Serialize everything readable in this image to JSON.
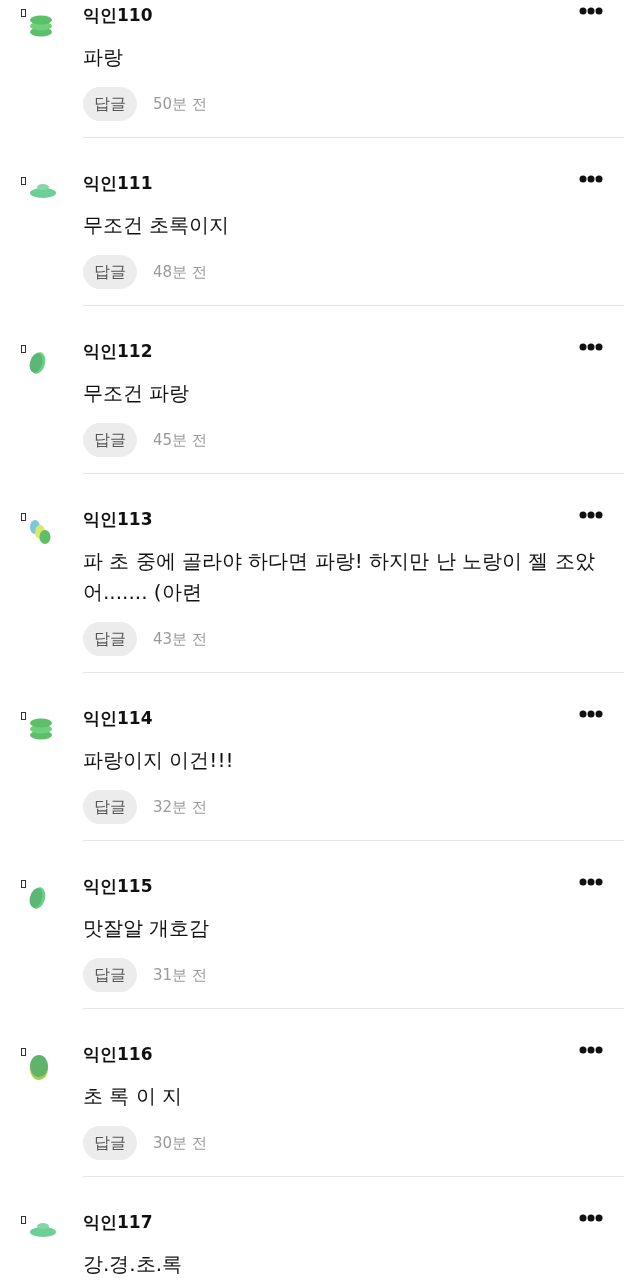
{
  "comments": [
    {
      "author": "익인110",
      "kind": "stack",
      "text": "파랑",
      "reply": "답글",
      "time": "50분 전"
    },
    {
      "author": "익인111",
      "kind": "flat",
      "text": "무조건 초록이지",
      "reply": "답글",
      "time": "48분 전"
    },
    {
      "author": "익인112",
      "kind": "tilted",
      "text": "무조건 파랑",
      "reply": "답글",
      "time": "45분 전"
    },
    {
      "author": "익인113",
      "kind": "trio",
      "text": "파 초 중에 골라야 하다면 파랑! 하지만 난 노랑이 젤 조았어....... (아련",
      "reply": "답글",
      "time": "43분 전"
    },
    {
      "author": "익인114",
      "kind": "stack",
      "text": "파랑이지 이건!!!",
      "reply": "답글",
      "time": "32분 전"
    },
    {
      "author": "익인115",
      "kind": "tilted",
      "text": "맛잘알 개호감",
      "reply": "답글",
      "time": "31분 전"
    },
    {
      "author": "익인116",
      "kind": "round",
      "text": "초 록 이 지",
      "reply": "답글",
      "time": "30분 전"
    },
    {
      "author": "익인117",
      "kind": "flat",
      "text": "강.경.초.록"
    }
  ]
}
